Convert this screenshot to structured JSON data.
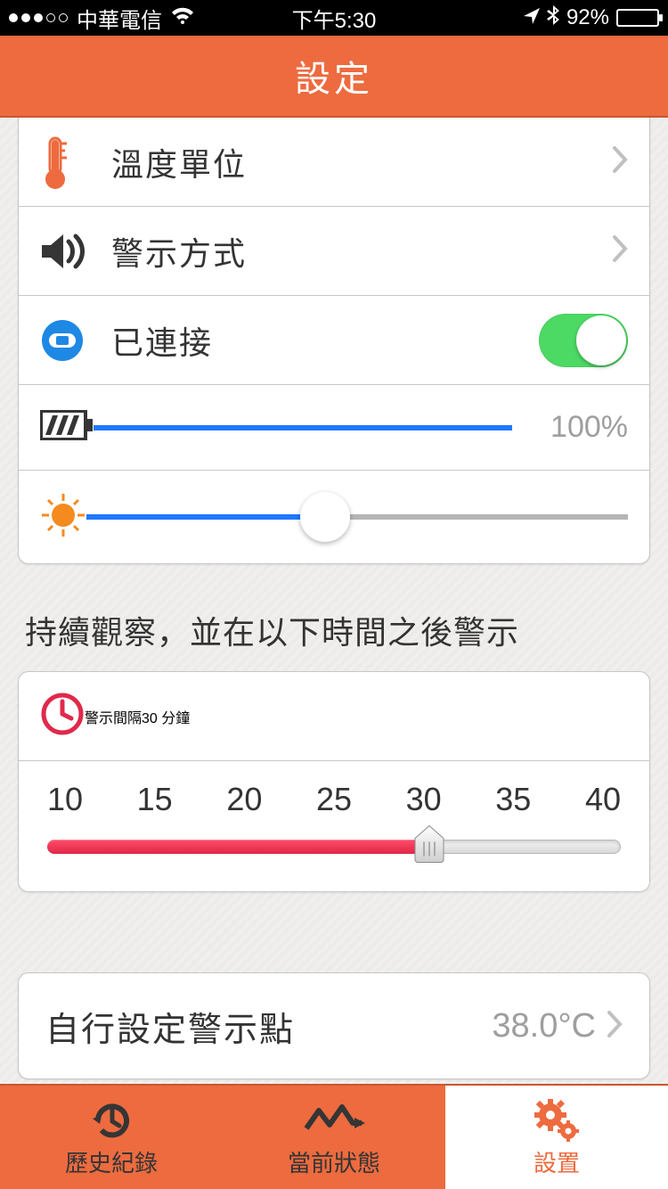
{
  "status": {
    "carrier": "中華電信",
    "time": "下午5:30",
    "battery": "92%"
  },
  "header": {
    "title": "設定"
  },
  "settings": {
    "temperature_unit_label": "溫度單位",
    "alert_method_label": "警示方式",
    "connected_label": "已連接",
    "connected_on": true,
    "battery_percent": "100%",
    "battery_value": 100,
    "brightness_value": 44
  },
  "interval": {
    "section_title": "持續觀察，並在以下時間之後警示",
    "label": "警示間隔",
    "value_text": "30 分鐘",
    "ticks": [
      "10",
      "15",
      "20",
      "25",
      "30",
      "35",
      "40"
    ],
    "selected_index": 4
  },
  "custom_alert": {
    "label": "自行設定警示點",
    "value": "38.0°C"
  },
  "tabs": {
    "history": "歷史紀錄",
    "current": "當前狀態",
    "settings": "設置"
  }
}
